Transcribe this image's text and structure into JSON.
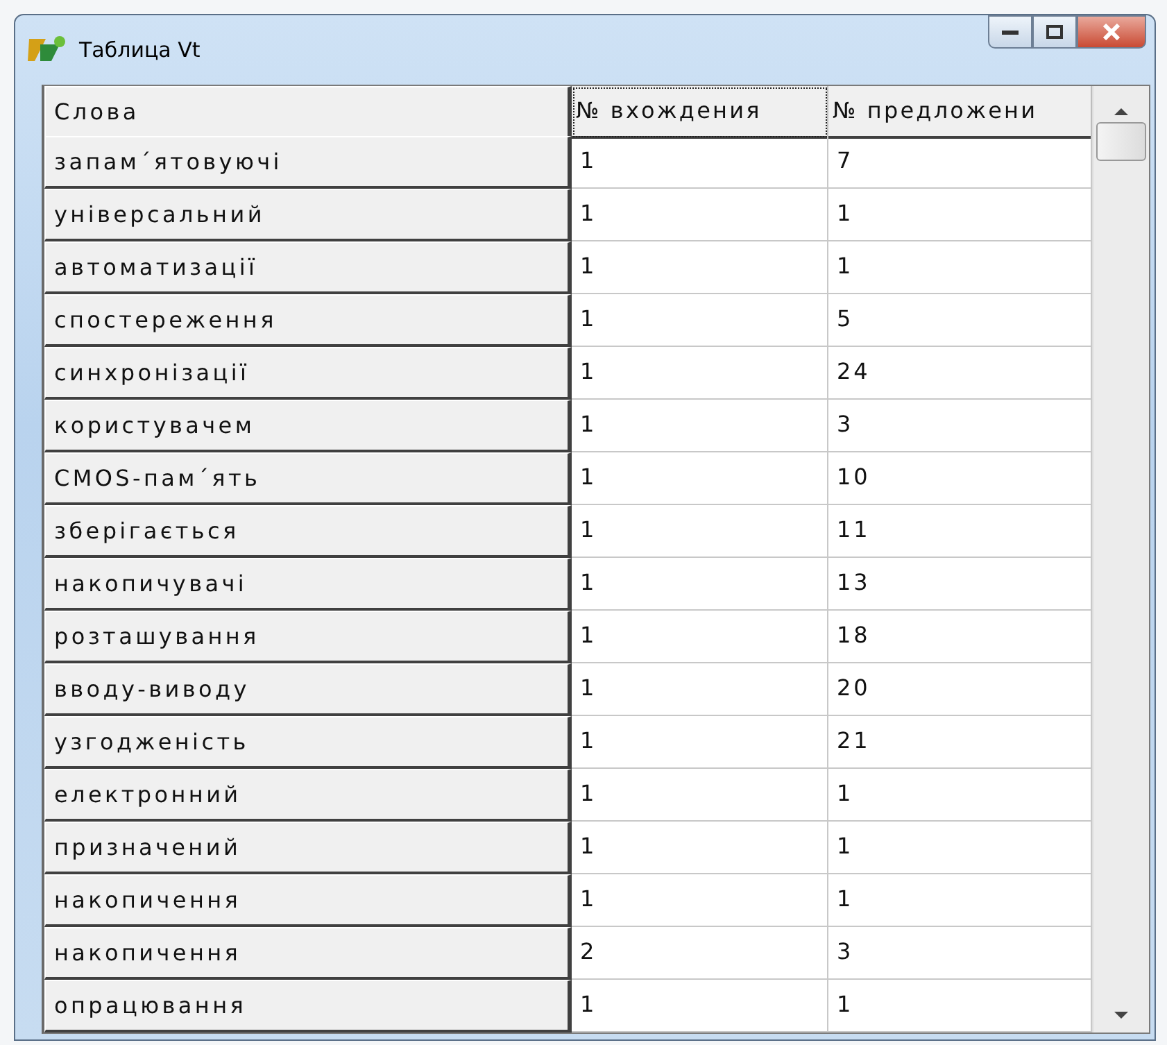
{
  "window": {
    "title": "Таблица Vt"
  },
  "table": {
    "columns": [
      {
        "label": "Слова",
        "focused": false
      },
      {
        "label": "№ вхождения",
        "focused": true
      },
      {
        "label": "№ предложени",
        "focused": false
      }
    ],
    "rows": [
      [
        "запам´ятовуючі",
        "1",
        "7"
      ],
      [
        "універсальний",
        "1",
        "1"
      ],
      [
        "автоматизації",
        "1",
        "1"
      ],
      [
        "спостереження",
        "1",
        "5"
      ],
      [
        "синхронізації",
        "1",
        "24"
      ],
      [
        "користувачем",
        "1",
        "3"
      ],
      [
        "CMOS-пам´ять",
        "1",
        "10"
      ],
      [
        "зберігається",
        "1",
        "11"
      ],
      [
        "накопичувачі",
        "1",
        "13"
      ],
      [
        "розташування",
        "1",
        "18"
      ],
      [
        "вводу-виводу",
        "1",
        "20"
      ],
      [
        "узгодженість",
        "1",
        "21"
      ],
      [
        "електронний",
        "1",
        "1"
      ],
      [
        "призначений",
        "1",
        "1"
      ],
      [
        "накопичення",
        "1",
        "1"
      ],
      [
        "накопичення",
        "2",
        "3"
      ],
      [
        "опрацювання",
        "1",
        "1"
      ]
    ]
  }
}
